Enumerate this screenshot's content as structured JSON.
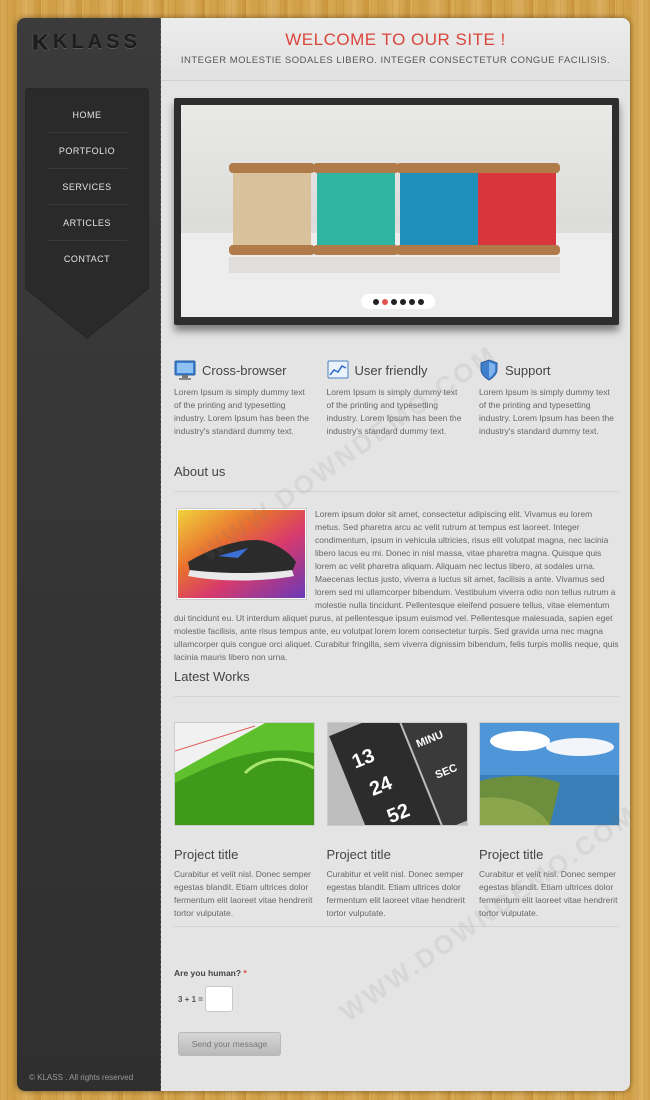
{
  "logo": {
    "text": "KLASS"
  },
  "nav": {
    "items": [
      "HOME",
      "PORTFOLIO",
      "SERVICES",
      "ARTICLES",
      "CONTACT"
    ]
  },
  "header": {
    "title": "WELCOME TO OUR SITE !",
    "subtitle": "INTEGER MOLESTIE SODALES LIBERO. INTEGER CONSECTETUR CONGUE FACILISIS."
  },
  "slider": {
    "dot_count": 6,
    "active_dot": 2
  },
  "features": [
    {
      "title": "Cross-browser",
      "icon": "monitor-icon",
      "text": "Lorem Ipsum is simply dummy text of the printing and typesetting industry. Lorem Ipsum has been the industry's standard dummy text."
    },
    {
      "title": "User friendly",
      "icon": "chart-icon",
      "text": "Lorem Ipsum is simply dummy text of the printing and typesetting industry. Lorem Ipsum has been the industry's standard dummy text."
    },
    {
      "title": "Support",
      "icon": "shield-icon",
      "text": "Lorem Ipsum is simply dummy text of the printing and typesetting industry. Lorem Ipsum has been the industry's standard dummy text."
    }
  ],
  "about": {
    "title": "About us",
    "text": "Lorem ipsum dolor sit amet, consectetur adipiscing elit. Vivamus eu lorem metus. Sed pharetra arcu ac velit rutrum at tempus est laoreet. Integer condimentum, ipsum in vehicula ultricies, risus elit volutpat magna, nec lacinia libero lacus eu mi. Donec in nisl massa, vitae pharetra magna. Quisque quis lorem ac velit pharetra aliquam. Aliquam nec lectus libero, at sodales urna. Maecenas lectus justo, viverra a luctus sit amet, facilisis a ante. Vivamus sed lorem sed mi ullamcorper bibendum. Vestibulum viverra odio non tellus rutrum a molestie nulla tincidunt. Pellentesque eleifend posuere tellus, vitae elementum dui tincidunt eu. Ut interdum aliquet purus, at pellentesque ipsum euismod vel. Pellentesque malesuada, sapien eget molestie facilisis, ante risus tempus ante, eu volutpat lorem lorem consectetur turpis. Sed gravida urna nec magna ullamcorper quis congue orci aliquet. Curabitur fringilla, sem viverra dignissim bibendum, felis turpis mollis neque, quis lacinia mauris libero non urna."
  },
  "works": {
    "title": "Latest Works",
    "items": [
      {
        "title": "Project title",
        "text": "Curabitur et velit nisl. Donec semper egestas blandit. Etiam ultrices dolor fermentum elit laoreet vitae hendrerit tortor vulputate."
      },
      {
        "title": "Project title",
        "text": "Curabitur et velit nisl. Donec semper egestas blandit. Etiam ultrices dolor fermentum elit laoreet vitae hendrerit tortor vulputate."
      },
      {
        "title": "Project title",
        "text": "Curabitur et velit nisl. Donec semper egestas blandit. Etiam ultrices dolor fermentum elit laoreet vitae hendrerit tortor vulputate."
      }
    ],
    "image_labels": {
      "cal_1": "13",
      "cal_2": "24",
      "cal_3": "52",
      "cal_minute": "MINU",
      "cal_sec": "SEC"
    }
  },
  "form": {
    "captcha_label": "Are you human?",
    "required_mark": "*",
    "captcha_question": "3 + 1 =",
    "captcha_value": "",
    "send_label": "Send your message"
  },
  "footer": {
    "copyright": "© KLASS . All rights reserved"
  },
  "colors": {
    "accent": "#d9463b",
    "sidebar": "#333333",
    "content": "#e4e4e4",
    "wood": "#d4a24c"
  }
}
